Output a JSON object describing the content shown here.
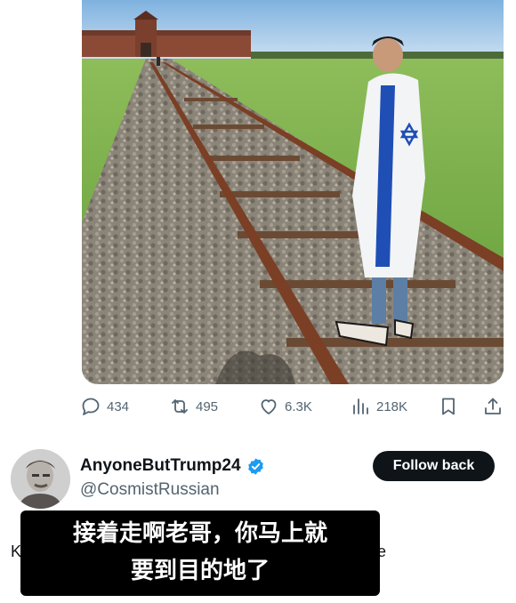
{
  "tweet": {
    "image_alt": "Man wrapped in Israeli flag standing on railway tracks",
    "stats": {
      "replies": "434",
      "reposts": "495",
      "likes": "6.3K",
      "views": "218K"
    }
  },
  "profile": {
    "display_name": "AnyoneButTrump24",
    "handle": "@CosmistRussian",
    "verified": true,
    "follow_label": "Follow back",
    "bio_left_fragment": "K",
    "bio_right_fragment": "e"
  },
  "subtitle": {
    "line1": "接着走啊老哥，你马上就",
    "line2": "要到目的地了"
  },
  "colors": {
    "icon_gray": "#536471",
    "verified_blue": "#1d9bf0",
    "follow_bg": "#0f1419",
    "subtitle_bg": "#000000"
  },
  "icons": [
    "reply-icon",
    "retweet-icon",
    "heart-icon",
    "views-icon",
    "bookmark-icon",
    "share-icon",
    "verified-badge-icon"
  ]
}
